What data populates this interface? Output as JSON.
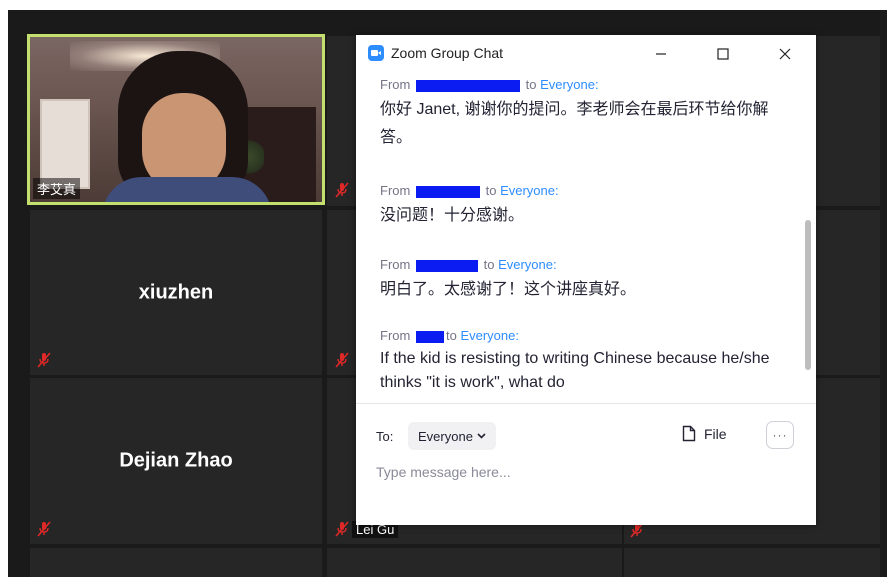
{
  "participants": {
    "video": {
      "name": "李艾真"
    },
    "tiles": [
      {
        "id": "t2",
        "name": ""
      },
      {
        "id": "t3",
        "name": ""
      },
      {
        "id": "xiuzhen",
        "name": "xiuzhen"
      },
      {
        "id": "t5",
        "name": ""
      },
      {
        "id": "t6",
        "name": ""
      },
      {
        "id": "dejian",
        "name": "Dejian Zhao"
      },
      {
        "id": "leigu",
        "name": "",
        "label": "Lei Gu"
      },
      {
        "id": "t9",
        "name": ""
      }
    ]
  },
  "chat": {
    "title": "Zoom Group Chat",
    "messages": [
      {
        "from_label": "From",
        "to_label": "to",
        "recipient": "Everyone:",
        "body": "你好 Janet, 谢谢你的提问。李老师会在最后环节给你解答。"
      },
      {
        "from_label": "From",
        "to_label": "to",
        "recipient": "Everyone:",
        "body": "没问题！十分感谢。"
      },
      {
        "from_label": "From",
        "to_label": "to",
        "recipient": "Everyone:",
        "body": "明白了。太感谢了！这个讲座真好。"
      },
      {
        "from_label": "From",
        "to_label": "to",
        "recipient": "Everyone:",
        "body": "If the kid is resisting to writing Chinese because he/she thinks \"it is work\", what do"
      }
    ],
    "composer": {
      "to_label": "To:",
      "recipient": "Everyone",
      "file_label": "File",
      "more_label": "···",
      "placeholder": "Type message here..."
    }
  },
  "colors": {
    "active_speaker_border": "#c3e06f",
    "zoom_blue": "#2d8cff",
    "redaction": "#0a1cf2",
    "mute_red": "#e02828"
  }
}
